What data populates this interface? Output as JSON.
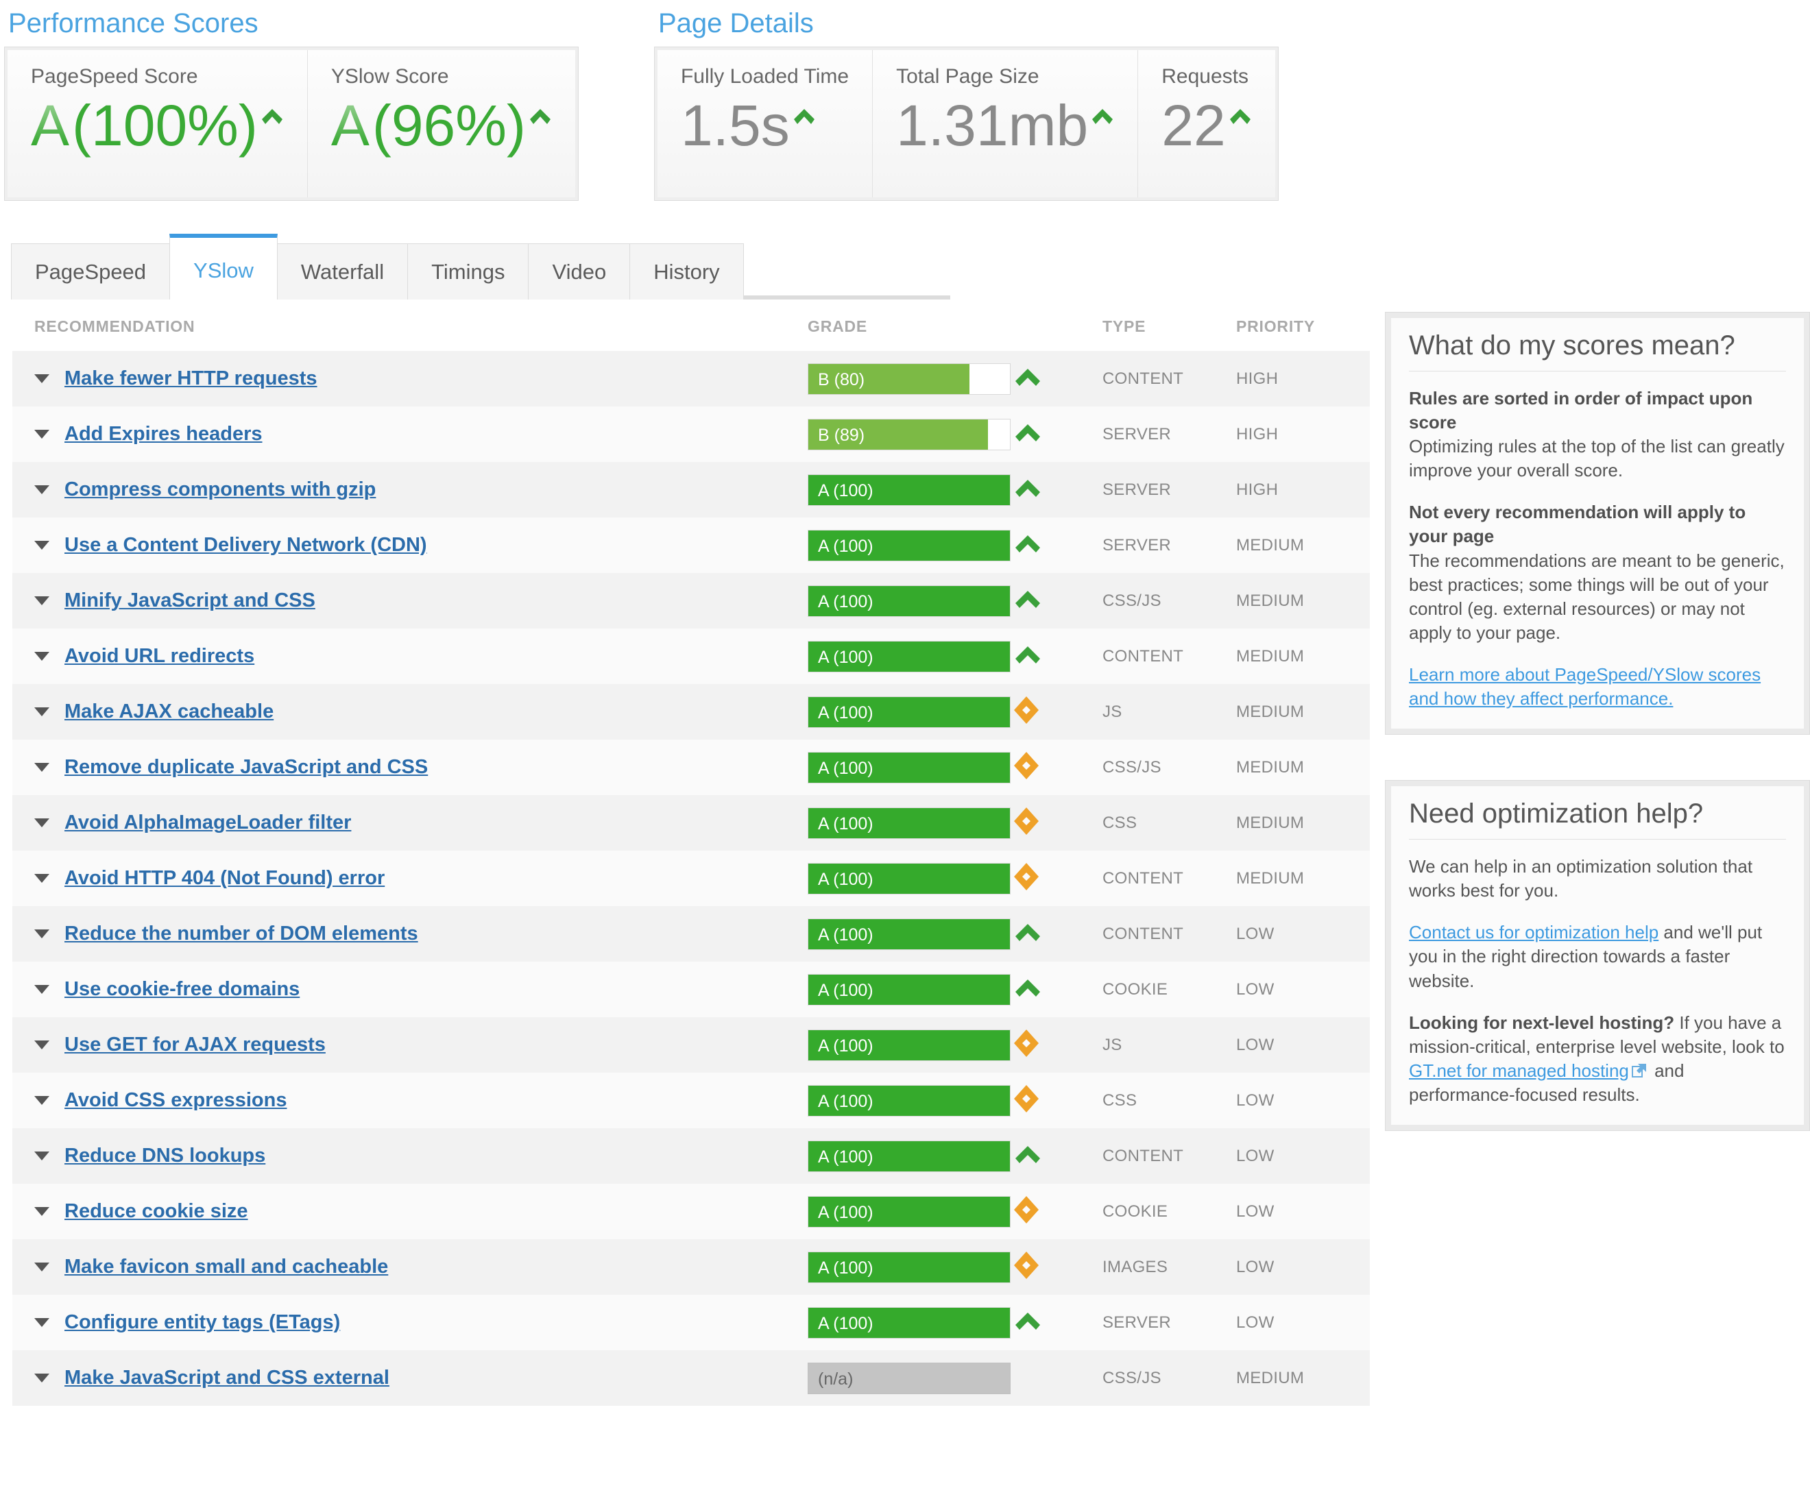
{
  "performance": {
    "title": "Performance Scores",
    "cards": [
      {
        "label": "PageSpeed Score",
        "grade": "A",
        "value": "(100%)"
      },
      {
        "label": "YSlow Score",
        "grade": "A",
        "value": "(96%)"
      }
    ]
  },
  "page_details": {
    "title": "Page Details",
    "cards": [
      {
        "label": "Fully Loaded Time",
        "value": "1.5s"
      },
      {
        "label": "Total Page Size",
        "value": "1.31mb"
      },
      {
        "label": "Requests",
        "value": "22"
      }
    ]
  },
  "tabs": [
    {
      "label": "PageSpeed",
      "active": false
    },
    {
      "label": "YSlow",
      "active": true
    },
    {
      "label": "Waterfall",
      "active": false
    },
    {
      "label": "Timings",
      "active": false
    },
    {
      "label": "Video",
      "active": false
    },
    {
      "label": "History",
      "active": false
    }
  ],
  "table": {
    "headers": [
      "RECOMMENDATION",
      "GRADE",
      "TYPE",
      "PRIORITY"
    ],
    "rows": [
      {
        "recommendation": "Make fewer HTTP requests",
        "grade": "B (80)",
        "score": 80,
        "grade_class": "b",
        "icon": "chevron-up",
        "type": "CONTENT",
        "priority": "HIGH"
      },
      {
        "recommendation": "Add Expires headers",
        "grade": "B (89)",
        "score": 89,
        "grade_class": "b",
        "icon": "chevron-up",
        "type": "SERVER",
        "priority": "HIGH"
      },
      {
        "recommendation": "Compress components with gzip",
        "grade": "A (100)",
        "score": 100,
        "grade_class": "a",
        "icon": "chevron-up",
        "type": "SERVER",
        "priority": "HIGH"
      },
      {
        "recommendation": "Use a Content Delivery Network (CDN)",
        "grade": "A (100)",
        "score": 100,
        "grade_class": "a",
        "icon": "chevron-up",
        "type": "SERVER",
        "priority": "MEDIUM"
      },
      {
        "recommendation": "Minify JavaScript and CSS",
        "grade": "A (100)",
        "score": 100,
        "grade_class": "a",
        "icon": "chevron-up",
        "type": "CSS/JS",
        "priority": "MEDIUM"
      },
      {
        "recommendation": "Avoid URL redirects",
        "grade": "A (100)",
        "score": 100,
        "grade_class": "a",
        "icon": "chevron-up",
        "type": "CONTENT",
        "priority": "MEDIUM"
      },
      {
        "recommendation": "Make AJAX cacheable",
        "grade": "A (100)",
        "score": 100,
        "grade_class": "a",
        "icon": "diamond",
        "type": "JS",
        "priority": "MEDIUM"
      },
      {
        "recommendation": "Remove duplicate JavaScript and CSS",
        "grade": "A (100)",
        "score": 100,
        "grade_class": "a",
        "icon": "diamond",
        "type": "CSS/JS",
        "priority": "MEDIUM"
      },
      {
        "recommendation": "Avoid AlphaImageLoader filter",
        "grade": "A (100)",
        "score": 100,
        "grade_class": "a",
        "icon": "diamond",
        "type": "CSS",
        "priority": "MEDIUM"
      },
      {
        "recommendation": "Avoid HTTP 404 (Not Found) error",
        "grade": "A (100)",
        "score": 100,
        "grade_class": "a",
        "icon": "diamond",
        "type": "CONTENT",
        "priority": "MEDIUM"
      },
      {
        "recommendation": "Reduce the number of DOM elements",
        "grade": "A (100)",
        "score": 100,
        "grade_class": "a",
        "icon": "chevron-up",
        "type": "CONTENT",
        "priority": "LOW"
      },
      {
        "recommendation": "Use cookie-free domains",
        "grade": "A (100)",
        "score": 100,
        "grade_class": "a",
        "icon": "chevron-up",
        "type": "COOKIE",
        "priority": "LOW"
      },
      {
        "recommendation": "Use GET for AJAX requests",
        "grade": "A (100)",
        "score": 100,
        "grade_class": "a",
        "icon": "diamond",
        "type": "JS",
        "priority": "LOW"
      },
      {
        "recommendation": "Avoid CSS expressions",
        "grade": "A (100)",
        "score": 100,
        "grade_class": "a",
        "icon": "diamond",
        "type": "CSS",
        "priority": "LOW"
      },
      {
        "recommendation": "Reduce DNS lookups",
        "grade": "A (100)",
        "score": 100,
        "grade_class": "a",
        "icon": "chevron-up",
        "type": "CONTENT",
        "priority": "LOW"
      },
      {
        "recommendation": "Reduce cookie size",
        "grade": "A (100)",
        "score": 100,
        "grade_class": "a",
        "icon": "diamond",
        "type": "COOKIE",
        "priority": "LOW"
      },
      {
        "recommendation": "Make favicon small and cacheable",
        "grade": "A (100)",
        "score": 100,
        "grade_class": "a",
        "icon": "diamond",
        "type": "IMAGES",
        "priority": "LOW"
      },
      {
        "recommendation": "Configure entity tags (ETags)",
        "grade": "A (100)",
        "score": 100,
        "grade_class": "a",
        "icon": "chevron-up",
        "type": "SERVER",
        "priority": "LOW"
      },
      {
        "recommendation": "Make JavaScript and CSS external",
        "grade": "(n/a)",
        "score": 0,
        "grade_class": "na",
        "icon": "none",
        "type": "CSS/JS",
        "priority": "MEDIUM"
      }
    ]
  },
  "sidebar": {
    "scores_panel": {
      "title": "What do my scores mean?",
      "p1_bold": "Rules are sorted in order of impact upon score",
      "p1_text": "Optimizing rules at the top of the list can greatly improve your overall score.",
      "p2_bold": "Not every recommendation will apply to your page",
      "p2_text": "The recommendations are meant to be generic, best practices; some things will be out of your control (eg. external resources) or may not apply to your page.",
      "link": "Learn more about PageSpeed/YSlow scores and how they affect performance."
    },
    "help_panel": {
      "title": "Need optimization help?",
      "p1": "We can help in an optimization solution that works best for you.",
      "p2_link": "Contact us for optimization help",
      "p2_text": " and we'll put you in the right direction towards a faster website.",
      "p3_bold": "Looking for next-level hosting?",
      "p3_text_a": " If you have a mission-critical, enterprise level website, look to ",
      "p3_link": "GT.net for managed hosting",
      "p3_text_b": " and performance-focused results."
    }
  },
  "colors": {
    "accent_blue": "#4aa3e0",
    "link_blue": "#2b6cab",
    "grade_a_green": "#35aa2c",
    "grade_b_green": "#7cba45",
    "chevron_green": "#3aa03a",
    "diamond_orange": "#efa128",
    "na_gray": "#c4c4c4"
  }
}
